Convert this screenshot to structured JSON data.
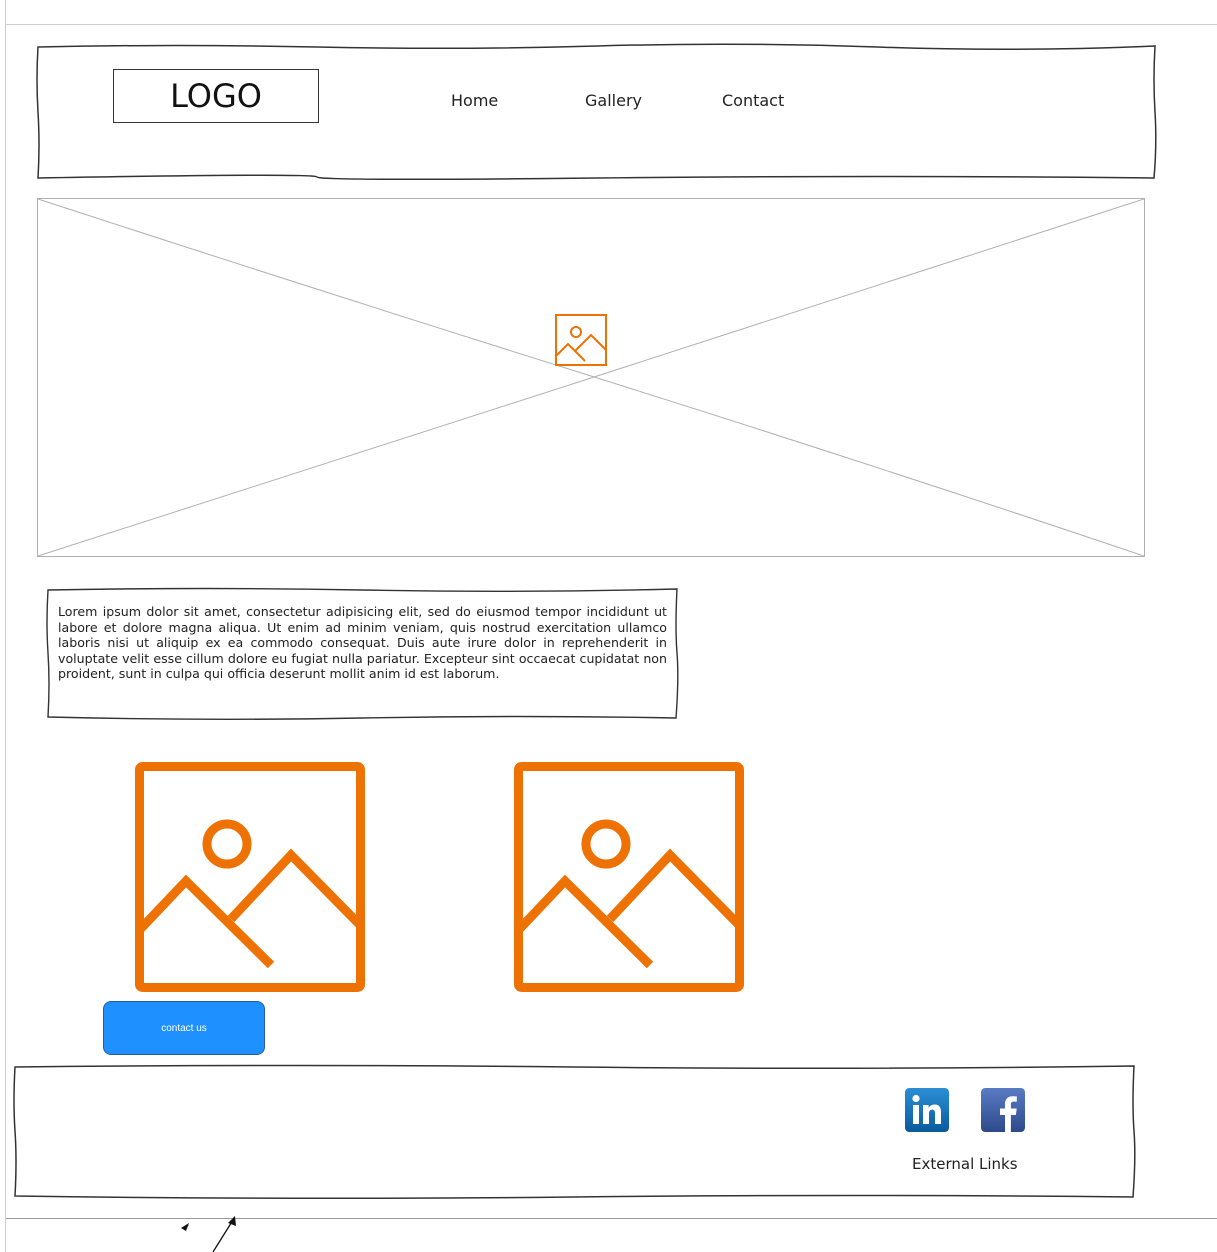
{
  "header": {
    "logo_text": "LOGO",
    "nav": [
      "Home",
      "Gallery",
      "Contact"
    ]
  },
  "intro": {
    "text": "Lorem ipsum dolor sit amet, consectetur adipisicing elit, sed do eiusmod tempor incididunt ut labore et dolore magna aliqua. Ut enim ad minim veniam, quis nostrud exercitation ullamco laboris nisi ut aliquip ex ea commodo consequat. Duis aute irure dolor in reprehenderit in voluptate velit esse cillum dolore eu fugiat nulla pariatur. Excepteur sint occaecat cupidatat non proident, sunt in culpa qui officia deserunt mollit anim id est laborum."
  },
  "cta": {
    "label": "contact us"
  },
  "footer": {
    "external_links_label": "External Links",
    "social": [
      {
        "name": "linkedin-icon",
        "glyph": "in"
      },
      {
        "name": "facebook-icon",
        "glyph": "f"
      }
    ]
  },
  "colors": {
    "accent_orange": "#ee7203",
    "button_blue": "#1e90ff",
    "linkedin_blue": "#0a66c2",
    "facebook_blue": "#3b5998"
  }
}
